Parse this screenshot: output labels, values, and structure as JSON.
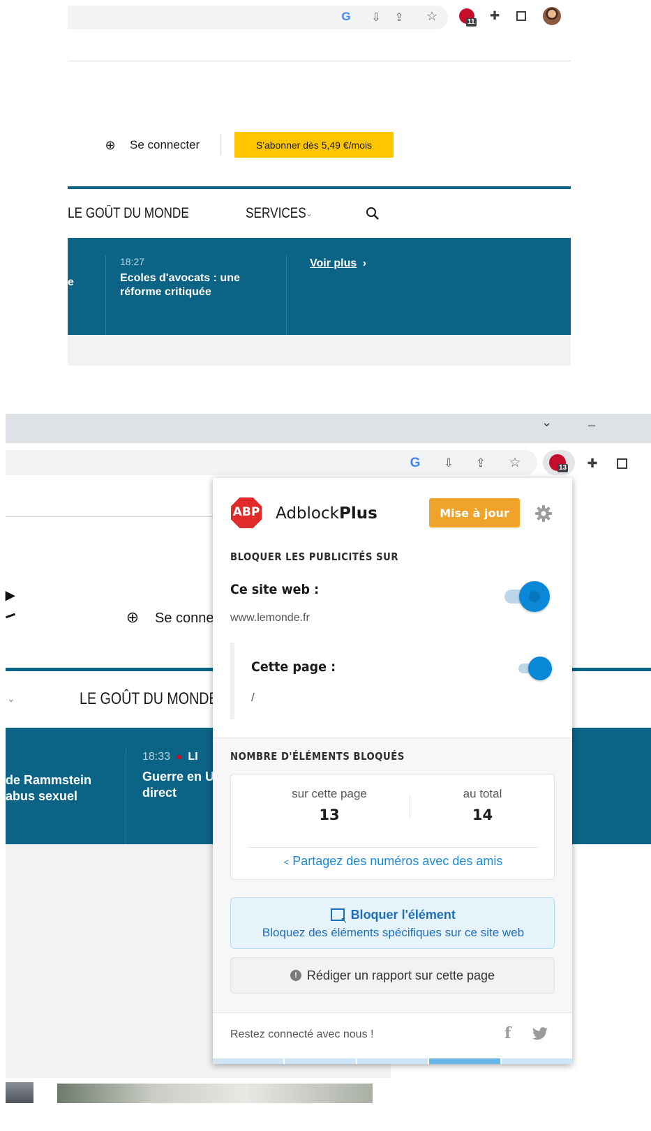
{
  "top_screenshot": {
    "toolbar": {
      "google_letter": "G",
      "icons": [
        "google-icon",
        "install-icon",
        "share-icon",
        "star-icon",
        "abp-icon",
        "puzzle-icon",
        "sidepanel-icon",
        "avatar"
      ],
      "abp_count": "11"
    },
    "header": {
      "login_label": "Se connecter",
      "subscribe_label": "S'abonner dès 5,49 €/mois",
      "subscribe_color": "#ffc600"
    },
    "nav": {
      "items": [
        "LE GOÛT DU MONDE",
        "SERVICES"
      ],
      "accent": "#0b6485"
    },
    "news": {
      "cut_text": "e",
      "time": "18:27",
      "title_line1": "Ecoles d'avocats : une",
      "title_line2": "réforme critiquée",
      "more_label": "Voir plus"
    }
  },
  "bottom_screenshot": {
    "window_controls": {
      "chevron": "⌄",
      "minimize": "–"
    },
    "toolbar": {
      "google_letter": "G",
      "abp_count": "13"
    },
    "page": {
      "login_label": "Se conne",
      "nav_item": "LE GOÛT DU MONDE",
      "news_left_line1": "de Rammstein",
      "news_left_line2": "abus sexuel",
      "news_time": "18:33",
      "news_live": "LI",
      "news_title_line1": "Guerre en U",
      "news_title_line2": "direct"
    },
    "popup": {
      "logo_text": "ABP",
      "brand_regular": "Adblock",
      "brand_bold": "Plus",
      "update_label": "Mise à jour",
      "update_color": "#f0a32a",
      "block_section_title": "BLOQUER LES PUBLICITÉS SUR",
      "site_label": "Ce site web :",
      "site_domain": "www.lemonde.fr",
      "page_label": "Cette page :",
      "page_path": "/",
      "count_section_title": "NOMBRE D'ÉLÉMENTS BLOQUÉS",
      "this_page_label": "sur cette page",
      "this_page_count": "13",
      "total_label": "au total",
      "total_count": "14",
      "share_label": "Partagez des numéros avec des amis",
      "block_element_title": "Bloquer l'élément",
      "block_element_desc": "Bloquez des éléments spécifiques sur ce site web",
      "report_label": "Rédiger un rapport sur cette page",
      "footer_text": "Restez connecté avec nous !",
      "accent": "#0a88d8"
    }
  }
}
